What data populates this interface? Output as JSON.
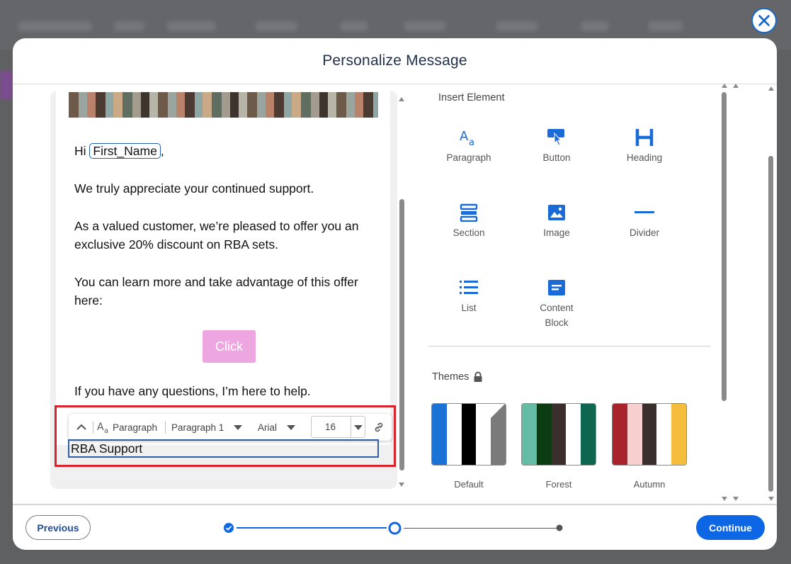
{
  "modal": {
    "title": "Personalize Message"
  },
  "email": {
    "greeting_prefix": "Hi",
    "merge_tag": "First_Name",
    "greeting_suffix": ",",
    "para1": "We truly appreciate your continued support.",
    "para2_line1": "As a valued customer, we’re pleased to offer you an",
    "para2_line2": "exclusive 20% discount on RBA sets.",
    "para3_line1": "You can learn more and take advantage of this offer",
    "para3_line2": "here:",
    "button_label": "Click",
    "para4": "If you have any questions, I’m here to help.",
    "signature_value": "RBA Support"
  },
  "toolbar": {
    "block_type": "Paragraph",
    "style": "Paragraph 1",
    "font": "Arial",
    "size": "16"
  },
  "insert": {
    "title": "Insert Element",
    "items": [
      {
        "label": "Paragraph",
        "icon": "paragraph-icon"
      },
      {
        "label": "Button",
        "icon": "button-icon"
      },
      {
        "label": "Heading",
        "icon": "heading-icon"
      },
      {
        "label": "Section",
        "icon": "section-icon"
      },
      {
        "label": "Image",
        "icon": "image-icon"
      },
      {
        "label": "Divider",
        "icon": "divider-icon"
      },
      {
        "label": "List",
        "icon": "list-icon"
      },
      {
        "label": "Content",
        "icon": "content-block-icon",
        "label2": "Block"
      }
    ]
  },
  "themes": {
    "title": "Themes",
    "items": [
      {
        "label": "Default",
        "colors": [
          "#1a73d4",
          "#ffffff",
          "#000000",
          "#ffffff",
          "#7a7a7a"
        ]
      },
      {
        "label": "Forest",
        "colors": [
          "#64bca4",
          "#0c3d12",
          "#3a2f2d",
          "#ffffff",
          "#0e6650"
        ]
      },
      {
        "label": "Autumn",
        "colors": [
          "#a8232b",
          "#f8cfcf",
          "#3a2f2d",
          "#ffffff",
          "#f4bd3c"
        ]
      }
    ]
  },
  "footer": {
    "previous_label": "Previous",
    "continue_label": "Continue",
    "steps_total": 3,
    "current_step": 2
  },
  "colors": {
    "accent": "#0d66e4",
    "title": "#1f2f4c",
    "highlight": "#d8232a",
    "cta": "#eea6e1"
  }
}
